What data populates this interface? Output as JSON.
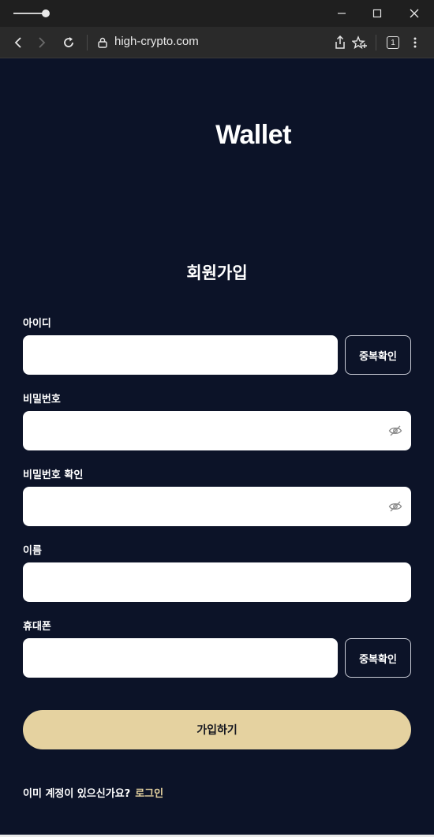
{
  "browser": {
    "url": "high-crypto.com",
    "tab_count": "1"
  },
  "page": {
    "logo": "Wallet",
    "heading": "회원가입",
    "fields": {
      "id_label": "아이디",
      "password_label": "비밀번호",
      "password_confirm_label": "비밀번호 확인",
      "name_label": "이름",
      "phone_label": "휴대폰"
    },
    "dup_check_label": "중복확인",
    "submit_label": "가입하기",
    "footer_text": "이미 계정이 있으신가요?",
    "login_link": "로그인"
  },
  "colors": {
    "background": "#0c1328",
    "accent": "#e5d2a0"
  }
}
